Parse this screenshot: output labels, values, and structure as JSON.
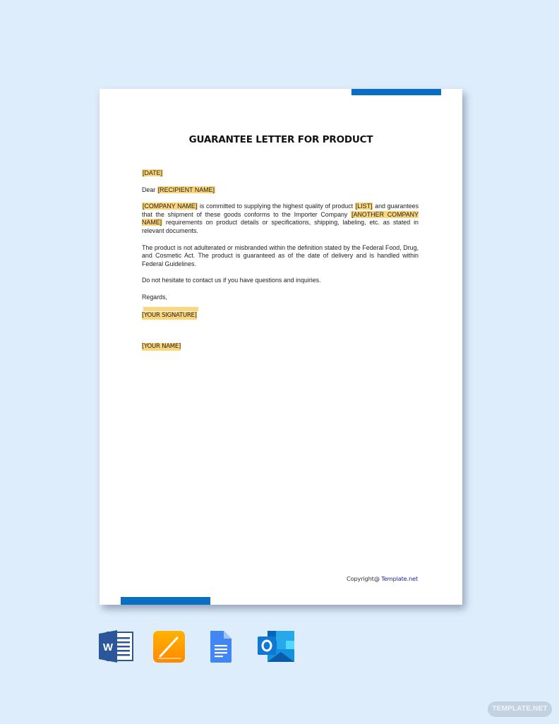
{
  "document": {
    "title": "GUARANTEE LETTER FOR PRODUCT",
    "date_placeholder": "[DATE]",
    "salutation": "Dear",
    "recipient_placeholder": "[RECIPIENT NAME]",
    "paragraph1": {
      "company_placeholder": "[COMPANY NAME]",
      "text_a": " is committed to supplying the highest quality of product ",
      "list_placeholder": "[LIST]",
      "text_b": " and guarantees that the shipment of these goods conforms to the Importer Company ",
      "another_company_placeholder": "[ANOTHER COMPANY NAME]",
      "text_c": " requirements on product details or specifications, shipping, labeling, etc. as stated in relevant documents."
    },
    "paragraph2": "The product is not adulterated or misbranded within the definition stated by the Federal Food, Drug, and Cosmetic Act. The product is guaranteed as of the date of delivery and is handled within Federal Guidelines.",
    "paragraph3": "Do not hesitate to contact us if you have questions and inquiries.",
    "closing": "Regards,",
    "signature_placeholder": "[YOUR SIGNATURE]",
    "name_placeholder": "[YOUR NAME]",
    "copyright_label": "Copyright@ ",
    "copyright_link": "Template.net"
  },
  "colors": {
    "background": "#deedfb",
    "accent_bar": "#0a6fc2",
    "highlight": "#fdd57a",
    "link": "#1e2a9a"
  },
  "formats": [
    {
      "name": "Microsoft Word",
      "icon": "word-icon",
      "letter": "W"
    },
    {
      "name": "Apple Pages",
      "icon": "pages-icon"
    },
    {
      "name": "Google Docs",
      "icon": "google-docs-icon"
    },
    {
      "name": "Microsoft Outlook",
      "icon": "outlook-icon",
      "letter": "O"
    }
  ],
  "watermark": "TEMPLATE.NET"
}
